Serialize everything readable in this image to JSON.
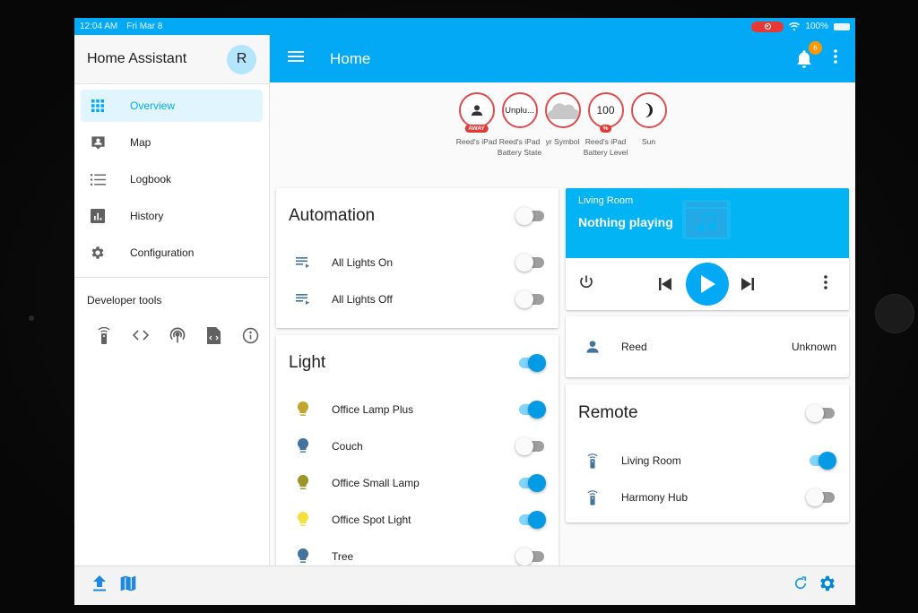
{
  "status_bar": {
    "time": "12:04 AM",
    "date": "Fri Mar 8",
    "battery": "100%"
  },
  "sidebar": {
    "title": "Home Assistant",
    "avatar_initial": "R",
    "items": [
      {
        "label": "Overview",
        "icon": "grid-icon",
        "active": true
      },
      {
        "label": "Map",
        "icon": "map-account-icon",
        "active": false
      },
      {
        "label": "Logbook",
        "icon": "list-icon",
        "active": false
      },
      {
        "label": "History",
        "icon": "chart-icon",
        "active": false
      },
      {
        "label": "Configuration",
        "icon": "gear-icon",
        "active": false
      }
    ],
    "developer_tools": {
      "title": "Developer tools",
      "icons": [
        "remote-icon",
        "code-icon",
        "broadcast-icon",
        "file-code-icon",
        "info-icon"
      ]
    }
  },
  "topbar": {
    "title": "Home",
    "notification_count": "6"
  },
  "badges": [
    {
      "value": "",
      "icon": "person-icon",
      "tag": "AWAY",
      "label": "Reed's iPad"
    },
    {
      "value": "Unplu...",
      "icon": "",
      "tag": "",
      "label": "Reed's iPad Battery State"
    },
    {
      "value": "",
      "icon": "cloud-icon",
      "tag": "",
      "label": "yr Symbol"
    },
    {
      "value": "100",
      "icon": "",
      "tag": "%",
      "label": "Reed's iPad Battery Level"
    },
    {
      "value": "",
      "icon": "moon-icon",
      "tag": "",
      "label": "Sun"
    }
  ],
  "automation_card": {
    "title": "Automation",
    "master_on": false,
    "rows": [
      {
        "label": "All Lights On",
        "on": false
      },
      {
        "label": "All Lights Off",
        "on": false
      }
    ]
  },
  "light_card": {
    "title": "Light",
    "master_on": true,
    "rows": [
      {
        "label": "Office Lamp Plus",
        "on": true,
        "color": "#c0a62b"
      },
      {
        "label": "Couch",
        "on": false,
        "color": "#44739e"
      },
      {
        "label": "Office Small Lamp",
        "on": true,
        "color": "#9c9428"
      },
      {
        "label": "Office Spot Light",
        "on": true,
        "color": "#f2e03c"
      },
      {
        "label": "Tree",
        "on": false,
        "color": "#44739e"
      }
    ]
  },
  "media_card": {
    "name": "Living Room",
    "state": "Nothing playing"
  },
  "person_card": {
    "name": "Reed",
    "state": "Unknown"
  },
  "remote_card": {
    "title": "Remote",
    "master_on": false,
    "rows": [
      {
        "label": "Living Room",
        "on": true
      },
      {
        "label": "Harmony Hub",
        "on": false
      }
    ]
  },
  "colors": {
    "primary": "#03a9f4",
    "badge_border": "#df4c4c",
    "state_icon": "#44739e",
    "notification_badge": "#ff9800"
  }
}
